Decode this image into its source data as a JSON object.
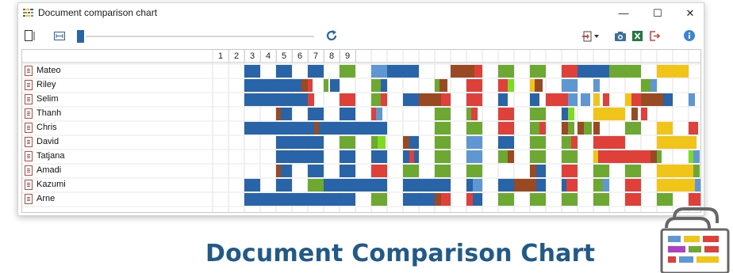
{
  "window": {
    "title": "Document comparison chart"
  },
  "window_controls": {
    "minimize": "—",
    "maximize": "☐",
    "close": "✕"
  },
  "toolbar": {
    "left_icons": [
      "document-icon",
      "fit-width-icon",
      "zoom-slider",
      "refresh-icon"
    ],
    "right_icons": [
      "export-dropdown-icon",
      "screenshot-icon",
      "excel-icon",
      "exit-icon",
      "info-icon"
    ]
  },
  "columns": {
    "headers": [
      "1",
      "2",
      "3",
      "4",
      "5",
      "6",
      "7",
      "8",
      "9"
    ]
  },
  "documents": [
    {
      "name": "Mateo",
      "icon": "audio-file-icon"
    },
    {
      "name": "Riley",
      "icon": "edit-file-icon"
    },
    {
      "name": "Selim",
      "icon": "text-file-icon"
    },
    {
      "name": "Thanh",
      "icon": "text-file-icon"
    },
    {
      "name": "Chris",
      "icon": "text-file-icon"
    },
    {
      "name": "David",
      "icon": "text-file-icon"
    },
    {
      "name": "Tatjana",
      "icon": "text-file-icon"
    },
    {
      "name": "Amadi",
      "icon": "text-file-icon"
    },
    {
      "name": "Kazumi",
      "icon": "text-file-icon"
    },
    {
      "name": "Arne",
      "icon": "text-file-icon"
    }
  ],
  "colors": {
    "blue": "#2a64a8",
    "green": "#6ca832",
    "red": "#e0403a",
    "brown": "#9a4a22",
    "lightblue": "#5e97d1",
    "yellow": "#f0c419",
    "lime": "#7ddc1f",
    "brand": "#1f5a8a"
  },
  "brand_text": "Document Comparison Chart"
}
